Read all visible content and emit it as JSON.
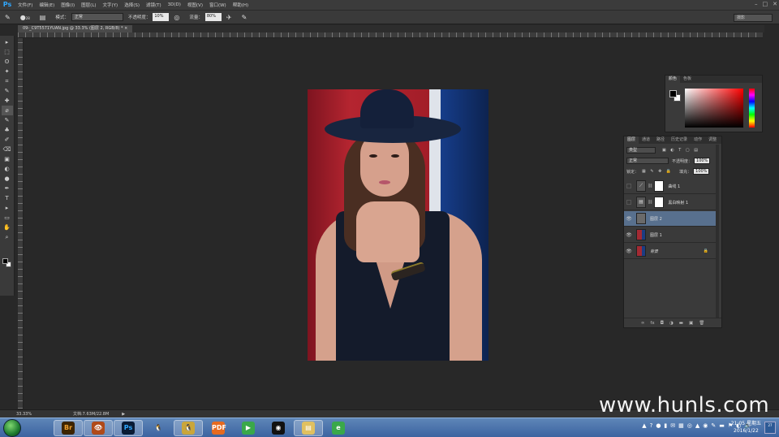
{
  "app": {
    "logo": "Ps",
    "window_controls": [
      "–",
      "□",
      "✕"
    ]
  },
  "menu": [
    "文件(F)",
    "编辑(E)",
    "图像(I)",
    "图层(L)",
    "文字(Y)",
    "选择(S)",
    "滤镜(T)",
    "3D(D)",
    "视图(V)",
    "窗口(W)",
    "帮助(H)"
  ],
  "options": {
    "brush_size": "28",
    "mode_label": "模式：",
    "mode_value": "正常",
    "opacity_label": "不透明度：",
    "opacity_value": "10%",
    "flow_label": "流量：",
    "flow_value": "80%",
    "workspace": "摄影"
  },
  "document": {
    "tab_title": "09-_C9T5571YUAN.jpg @ 33.3% (图层 2, RGB/8) *  ×"
  },
  "tools": [
    "▸",
    "⬚",
    "ʘ",
    "✦",
    "⌗",
    "✎",
    "✚",
    "⌀",
    "✎",
    "♣",
    "✐",
    "⌫",
    "▣",
    "◐",
    "●",
    "✒",
    "T",
    "▸",
    "▭",
    "✋",
    "⌕"
  ],
  "color_panel": {
    "tabs": [
      "颜色",
      "色板"
    ]
  },
  "layers_panel": {
    "tabs": [
      "图层",
      "通道",
      "路径",
      "历史记录",
      "动作",
      "调整"
    ],
    "filter_label": "类型",
    "blend_mode": "正常",
    "opacity_label": "不透明度：",
    "opacity_value": "100%",
    "lock_label": "锁定：",
    "fill_label": "填充：",
    "fill_value": "100%",
    "layers": [
      {
        "name": "曲线 1",
        "visible": false,
        "selected": false,
        "kind": "adjustment"
      },
      {
        "name": "黑白映射 1",
        "visible": false,
        "selected": false,
        "kind": "adjustment"
      },
      {
        "name": "图层 2",
        "visible": true,
        "selected": true,
        "kind": "pixel"
      },
      {
        "name": "图层 1",
        "visible": true,
        "selected": false,
        "kind": "photo"
      },
      {
        "name": "背景",
        "visible": true,
        "selected": false,
        "kind": "photo",
        "locked": true
      }
    ],
    "footer_icons": [
      "∞",
      "fx",
      "◘",
      "◑",
      "▬",
      "▣",
      "🗑"
    ]
  },
  "status": {
    "zoom": "33.33%",
    "doc_size": "文档:7.63M/22.8M"
  },
  "taskbar": {
    "apps": [
      {
        "name": "Br",
        "color": "#3d2400",
        "fg": "#f0a030",
        "active": true
      },
      {
        "name": "👁",
        "color": "#b04a1a",
        "fg": "#fff",
        "active": true
      },
      {
        "name": "Ps",
        "color": "#0a1b34",
        "fg": "#31a8ff",
        "active": true
      },
      {
        "name": "🐧",
        "color": "transparent",
        "fg": "#fff",
        "active": false
      },
      {
        "name": "🐧",
        "color": "#caa63a",
        "fg": "#fff",
        "active": true
      },
      {
        "name": "PDF",
        "color": "#e66a20",
        "fg": "#fff",
        "active": false
      },
      {
        "name": "▶",
        "color": "#3aa84a",
        "fg": "#fff",
        "active": false
      },
      {
        "name": "◉",
        "color": "#111",
        "fg": "#fff",
        "active": false
      },
      {
        "name": "▤",
        "color": "#e0c060",
        "fg": "#fff",
        "active": true
      },
      {
        "name": "e",
        "color": "#3aa84a",
        "fg": "#fff",
        "active": false
      }
    ],
    "tray_icons": [
      "▲",
      "?",
      "●",
      "▮",
      "✉",
      "▦",
      "◎",
      "▲",
      "◉",
      "✎",
      "▬",
      "⚑",
      "◐",
      "🔊"
    ],
    "time": "21:05 星期五",
    "date": "2016/1/22",
    "show_desktop": "27"
  },
  "watermark": "www.hunls.com"
}
